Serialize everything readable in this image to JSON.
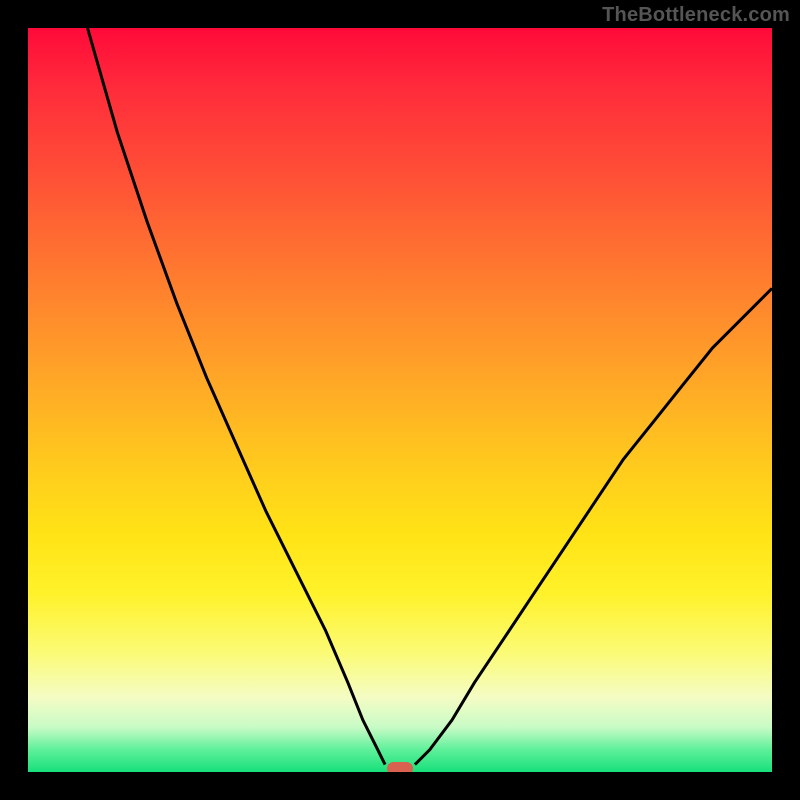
{
  "watermark": "TheBottleneck.com",
  "chart_data": {
    "type": "line",
    "title": "",
    "xlabel": "",
    "ylabel": "",
    "xlim": [
      0,
      100
    ],
    "ylim": [
      0,
      100
    ],
    "grid": false,
    "legend": false,
    "series": [
      {
        "name": "left-branch",
        "x": [
          8,
          12,
          16,
          20,
          24,
          28,
          32,
          36,
          40,
          43,
          45,
          47,
          48
        ],
        "values": [
          100,
          86,
          74,
          63,
          53,
          44,
          35,
          27,
          19,
          12,
          7,
          3,
          1
        ]
      },
      {
        "name": "right-branch",
        "x": [
          52,
          54,
          57,
          60,
          64,
          68,
          72,
          76,
          80,
          84,
          88,
          92,
          96,
          100
        ],
        "values": [
          1,
          3,
          7,
          12,
          18,
          24,
          30,
          36,
          42,
          47,
          52,
          57,
          61,
          65
        ]
      }
    ],
    "background_field": {
      "description": "vertical gradient mapping y=100 (red) → y=0 (green)",
      "stops": [
        {
          "y": 100,
          "color": "#ff0a3a"
        },
        {
          "y": 80,
          "color": "#ff5036"
        },
        {
          "y": 60,
          "color": "#ffa328"
        },
        {
          "y": 40,
          "color": "#ffe316"
        },
        {
          "y": 20,
          "color": "#fbfb76"
        },
        {
          "y": 5,
          "color": "#c8fbc6"
        },
        {
          "y": 0,
          "color": "#17e07a"
        }
      ]
    },
    "annotations": [
      {
        "name": "minimum-marker",
        "shape": "rounded-rect",
        "x": 50,
        "y": 0.5,
        "color": "#d8624f"
      }
    ]
  },
  "colors": {
    "frame": "#000000",
    "curve": "#000000",
    "marker": "#d8624f",
    "watermark": "#555555"
  }
}
